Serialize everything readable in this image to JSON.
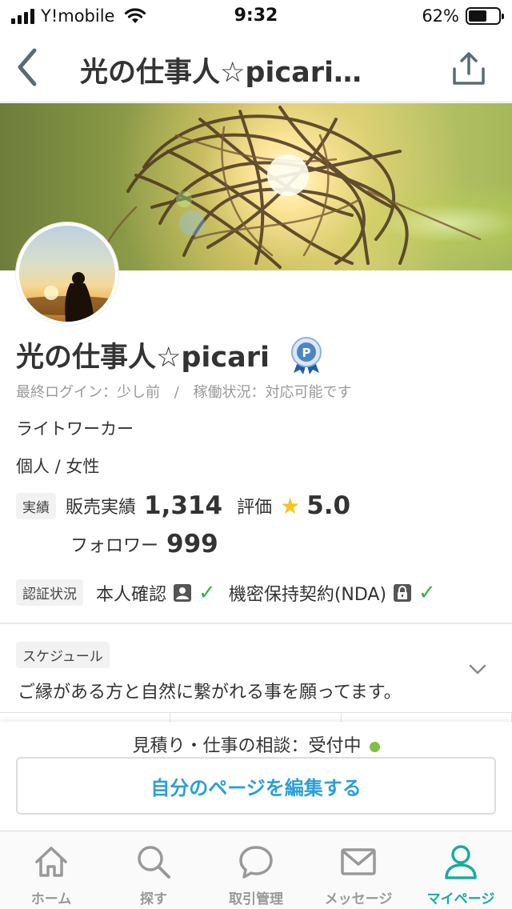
{
  "status_bar": {
    "carrier": "Y!mobile",
    "time": "9:32",
    "battery_percent": "62%",
    "battery_level": 0.62
  },
  "nav": {
    "title": "光の仕事人☆picari…"
  },
  "profile": {
    "name": "光の仕事人☆picari",
    "last_login": "最終ログイン：少し前",
    "separator": "/",
    "work_status": "稼働状況：対応可能です",
    "job": "ライトワーカー",
    "attributes": "個人 / 女性",
    "perf_tag": "実績",
    "sales_label": "販売実績",
    "sales_value": "1,314",
    "rating_label": "評価",
    "rating_value": "5.0",
    "follower_label": "フォロワー",
    "follower_value": "999",
    "verify_tag": "認証状況",
    "identity_label": "本人確認",
    "nda_label": "機密保持契約(NDA)"
  },
  "schedule": {
    "tag": "スケジュール",
    "text": "ご縁がある方と自然に繋がれる事を願ってます。"
  },
  "action": {
    "status": "見積り・仕事の相談：受付中",
    "status_color": "#7cc242",
    "edit_button": "自分のページを編集する",
    "accent": "#2b9fd8"
  },
  "tab_bar": {
    "items": [
      {
        "label": "ホーム",
        "icon": "home-icon"
      },
      {
        "label": "探す",
        "icon": "search-icon"
      },
      {
        "label": "取引管理",
        "icon": "chat-bubble-icon"
      },
      {
        "label": "メッセージ",
        "icon": "mail-icon"
      },
      {
        "label": "マイページ",
        "icon": "person-icon"
      }
    ],
    "active_color": "#1bab9f"
  }
}
